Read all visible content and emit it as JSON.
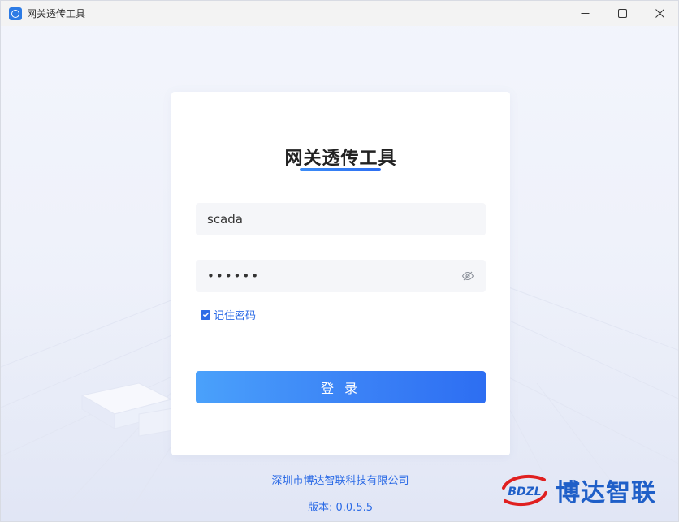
{
  "window": {
    "title": "网关透传工具",
    "icon": "app-icon",
    "controls": [
      "minimize-icon",
      "maximize-icon",
      "close-icon"
    ]
  },
  "login": {
    "heading": "网关透传工具",
    "username_value": "scada",
    "password_value": "••••••",
    "remember_label": "记住密码",
    "remember_checked": true,
    "submit_label": "登 录"
  },
  "footer": {
    "company": "深圳市博达智联科技有限公司",
    "version": "版本: 0.0.5.5"
  },
  "brand": {
    "mark_text": "BDZL",
    "name": "博达智联"
  },
  "colors": {
    "accent": "#2c6be6",
    "button_start": "#4aa1fb",
    "button_end": "#2d6ef2",
    "title_bar": "#f3f3f3",
    "brand_red": "#e02020"
  }
}
